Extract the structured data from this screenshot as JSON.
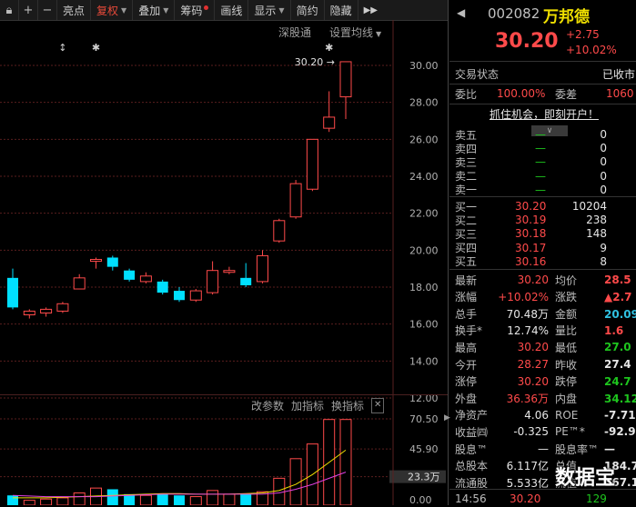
{
  "toolbar": {
    "icons": [
      "lock-icon",
      "plus-icon",
      "minus-icon"
    ],
    "buttons": [
      {
        "label": "亮点",
        "active": false,
        "dropdown": false,
        "dot": false
      },
      {
        "label": "复权",
        "active": true,
        "dropdown": true,
        "dot": false
      },
      {
        "label": "叠加",
        "active": false,
        "dropdown": true,
        "dot": false
      },
      {
        "label": "筹码",
        "active": false,
        "dropdown": false,
        "dot": true
      },
      {
        "label": "画线",
        "active": false,
        "dropdown": false,
        "dot": false
      },
      {
        "label": "显示",
        "active": false,
        "dropdown": true,
        "dot": false
      },
      {
        "label": "简约",
        "active": false,
        "dropdown": false,
        "dot": false
      },
      {
        "label": "隐藏",
        "active": false,
        "dropdown": false,
        "dot": false
      }
    ],
    "more": "▶▶"
  },
  "chart_links": {
    "shenzhen": "深股通",
    "ma_setting": "设置均线"
  },
  "indicator_links": {
    "change_params": "改参数",
    "add_indicator": "加指标",
    "swap_indicator": "换指标",
    "close": "✕"
  },
  "colors": {
    "up": "#ff4a4a",
    "down": "#00e0ff",
    "ma5": "#f0e000",
    "ma10": "#e040e0",
    "grid": "#5a1e1e"
  },
  "markers": [
    {
      "symbol": "↕",
      "index": 3
    },
    {
      "symbol": "✱",
      "index": 5
    },
    {
      "symbol": "✱",
      "index": 19
    }
  ],
  "chart_data": [
    {
      "type": "candlestick",
      "title": "",
      "ylim": [
        11.0,
        31.0
      ],
      "y_ticks": [
        "30.00",
        "28.00",
        "26.00",
        "24.00",
        "22.00",
        "20.00",
        "18.00",
        "16.00",
        "14.00",
        "12.00"
      ],
      "y_tick_values": [
        30,
        28,
        26,
        24,
        22,
        20,
        18,
        16,
        14,
        12
      ],
      "price_label": "30.20",
      "candles": [
        {
          "o": 18.5,
          "h": 19.0,
          "l": 16.8,
          "c": 16.9
        },
        {
          "o": 16.5,
          "h": 16.8,
          "l": 16.3,
          "c": 16.7
        },
        {
          "o": 16.6,
          "h": 16.9,
          "l": 16.4,
          "c": 16.8
        },
        {
          "o": 16.7,
          "h": 17.2,
          "l": 16.6,
          "c": 17.1
        },
        {
          "o": 17.9,
          "h": 18.7,
          "l": 17.9,
          "c": 18.5
        },
        {
          "o": 19.4,
          "h": 19.6,
          "l": 19.0,
          "c": 19.5
        },
        {
          "o": 19.6,
          "h": 19.7,
          "l": 18.9,
          "c": 19.1
        },
        {
          "o": 18.9,
          "h": 19.0,
          "l": 18.3,
          "c": 18.4
        },
        {
          "o": 18.3,
          "h": 18.8,
          "l": 18.2,
          "c": 18.6
        },
        {
          "o": 18.3,
          "h": 18.4,
          "l": 17.6,
          "c": 17.7
        },
        {
          "o": 17.8,
          "h": 18.0,
          "l": 17.2,
          "c": 17.3
        },
        {
          "o": 17.3,
          "h": 17.9,
          "l": 17.2,
          "c": 17.8
        },
        {
          "o": 17.7,
          "h": 19.4,
          "l": 17.6,
          "c": 18.9
        },
        {
          "o": 18.8,
          "h": 19.1,
          "l": 18.7,
          "c": 18.9
        },
        {
          "o": 18.5,
          "h": 19.3,
          "l": 18.0,
          "c": 18.1
        },
        {
          "o": 18.3,
          "h": 20.0,
          "l": 18.2,
          "c": 19.7
        },
        {
          "o": 20.5,
          "h": 21.7,
          "l": 20.4,
          "c": 21.6
        },
        {
          "o": 21.8,
          "h": 23.8,
          "l": 21.7,
          "c": 23.6
        },
        {
          "o": 23.3,
          "h": 26.0,
          "l": 23.2,
          "c": 26.0
        },
        {
          "o": 26.6,
          "h": 28.6,
          "l": 26.4,
          "c": 27.2
        },
        {
          "o": 28.3,
          "h": 30.2,
          "l": 27.1,
          "c": 30.2
        }
      ]
    },
    {
      "type": "bar",
      "title": "",
      "ylim": [
        0,
        72
      ],
      "y_ticks": [
        "70.50",
        "45.90",
        "23.3万",
        "0.00"
      ],
      "y_tick_values": [
        70.5,
        45.9,
        23.3,
        0
      ],
      "highlight_tick": "23.3万",
      "series": [
        {
          "values": [
            8,
            4,
            5,
            6,
            10,
            14,
            13,
            9,
            8,
            9,
            8,
            7,
            12,
            9,
            9,
            11,
            22,
            38,
            50,
            70,
            70
          ]
        }
      ],
      "ma_lines": [
        {
          "color": "#f0e000",
          "values": [
            6,
            6,
            6,
            6.5,
            7,
            7.5,
            8,
            8.5,
            9,
            9.5,
            9.5,
            9,
            9,
            9,
            9.5,
            10,
            12,
            17,
            25,
            35,
            45
          ]
        },
        {
          "color": "#e040e0",
          "values": [
            8,
            7.5,
            7,
            7,
            7,
            7,
            7.5,
            8,
            8.5,
            9,
            9,
            9,
            9,
            9,
            9,
            9,
            10,
            13,
            17,
            22,
            27
          ]
        }
      ]
    }
  ],
  "quote": {
    "code": "002082",
    "name": "万邦德",
    "price": "30.20",
    "change": "+2.75",
    "change_pct": "+10.02%"
  },
  "status": {
    "label": "交易状态",
    "value": "已收市"
  },
  "weibi": {
    "label1": "委比",
    "value1": "100.00%",
    "label2": "委差",
    "value2": "1060"
  },
  "promo": "抓住机会，即刻开户！",
  "sell_rows": [
    {
      "label": "卖五",
      "price": "—",
      "vol": "0"
    },
    {
      "label": "卖四",
      "price": "—",
      "vol": "0"
    },
    {
      "label": "卖三",
      "price": "—",
      "vol": "0"
    },
    {
      "label": "卖二",
      "price": "—",
      "vol": "0"
    },
    {
      "label": "卖一",
      "price": "—",
      "vol": "0"
    }
  ],
  "buy_rows": [
    {
      "label": "买一",
      "price": "30.20",
      "vol": "10204"
    },
    {
      "label": "买二",
      "price": "30.19",
      "vol": "238"
    },
    {
      "label": "买三",
      "price": "30.18",
      "vol": "148"
    },
    {
      "label": "买四",
      "price": "30.17",
      "vol": "9"
    },
    {
      "label": "买五",
      "price": "30.16",
      "vol": "8"
    }
  ],
  "stats": [
    {
      "l1": "最新",
      "v1": "30.20",
      "c1": "red",
      "l2": "均价",
      "v2": "28.5",
      "c2": "red"
    },
    {
      "l1": "涨幅",
      "v1": "+10.02%",
      "c1": "red",
      "l2": "涨跌",
      "v2": "▲2.7",
      "c2": "red"
    },
    {
      "l1": "总手",
      "v1": "70.48万",
      "c1": "wht",
      "l2": "金额",
      "v2": "20.09亿",
      "c2": "cyn"
    },
    {
      "l1": "换手*",
      "v1": "12.74%",
      "c1": "wht",
      "l2": "量比",
      "v2": "1.6",
      "c2": "red"
    },
    {
      "l1": "最高",
      "v1": "30.20",
      "c1": "red",
      "l2": "最低",
      "v2": "27.0",
      "c2": "grn"
    },
    {
      "l1": "今开",
      "v1": "28.27",
      "c1": "red",
      "l2": "昨收",
      "v2": "27.4",
      "c2": "wht"
    },
    {
      "l1": "涨停",
      "v1": "30.20",
      "c1": "red",
      "l2": "跌停",
      "v2": "24.7",
      "c2": "grn"
    },
    {
      "l1": "外盘",
      "v1": "36.36万",
      "c1": "red",
      "l2": "内盘",
      "v2": "34.12万",
      "c2": "grn"
    },
    {
      "l1": "净资产",
      "v1": "4.06",
      "c1": "wht",
      "l2": "ROE",
      "v2": "-7.71",
      "c2": "wht"
    },
    {
      "l1": "收益㈣",
      "v1": "-0.325",
      "c1": "wht",
      "l2": "PE™*",
      "v2": "-92.9",
      "c2": "wht"
    },
    {
      "l1": "股息™",
      "v1": "—",
      "c1": "wht",
      "l2": "股息率™",
      "v2": "—",
      "c2": "wht"
    },
    {
      "l1": "总股本",
      "v1": "6.117亿",
      "c1": "wht",
      "l2": "总值",
      "v2": "184.7",
      "c2": "wht"
    },
    {
      "l1": "流通股",
      "v1": "5.533亿",
      "c1": "wht",
      "l2": "流值",
      "v2": "167.1",
      "c2": "wht"
    }
  ],
  "tick": {
    "time": "14:56",
    "price": "30.20",
    "vol": "129"
  },
  "watermark": "数据宝"
}
